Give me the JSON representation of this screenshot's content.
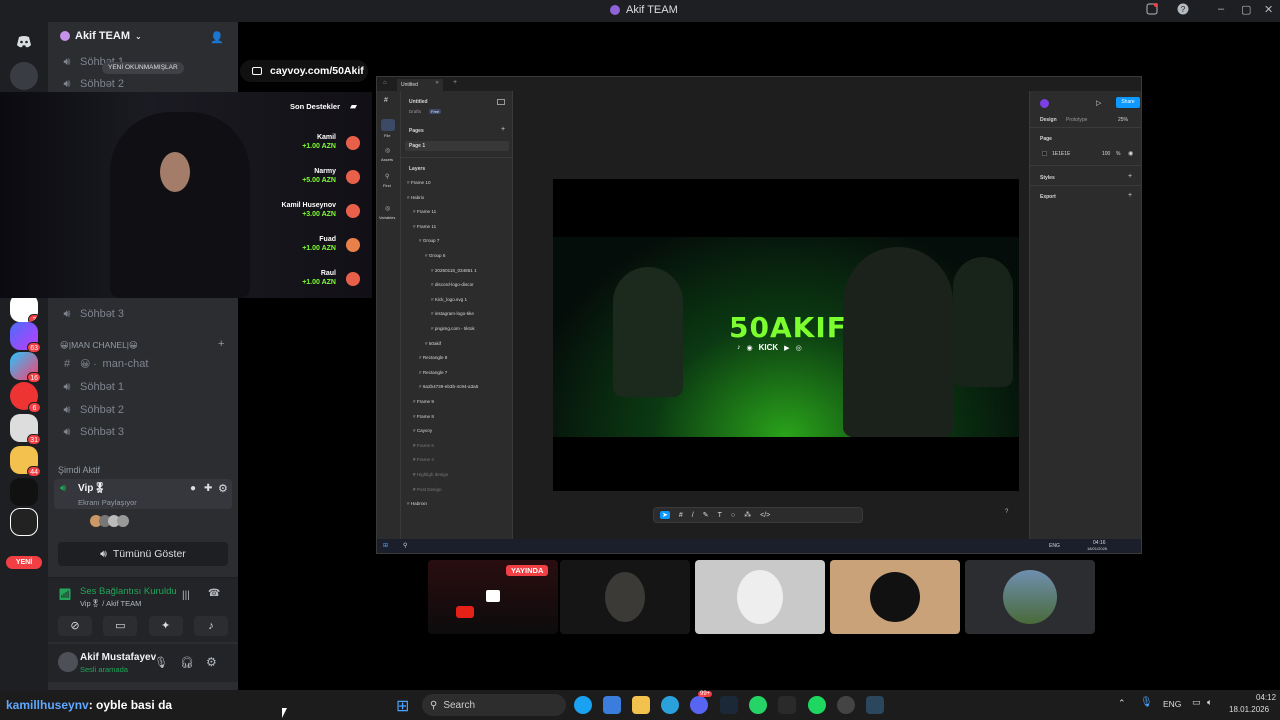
{
  "window": {
    "title": "Akif TEAM"
  },
  "server": {
    "name": "Akif TEAM",
    "unread_pill": "YENİ OKUNMAMIŞLAR",
    "new_label": "YENİ",
    "badges": [
      "3",
      "63",
      "16",
      "6",
      "31",
      "44"
    ]
  },
  "channels": {
    "top": [
      "Söhbət 1",
      "Söhbət 2"
    ],
    "more": [
      "Söhbət 3"
    ],
    "category": "😀|MAN CHANEL|😀",
    "text_channel": "man-chat",
    "list": [
      "Söhbət 1",
      "Söhbət 2",
      "Söhbət 3"
    ]
  },
  "active_now": {
    "heading": "Şimdi Aktif",
    "channel": "Vip🎖",
    "activity": "Ekranı Paylaşıyor",
    "show_all": "Tümünü Göster"
  },
  "voice_panel": {
    "status": "Ses Bağlantısı Kuruldu",
    "location": "Vip🎖 / Akif TEAM"
  },
  "user": {
    "name": "Akif Mustafayev",
    "status": "Sesli aramada"
  },
  "overlay": {
    "url": "cayvoy.com/50Akif",
    "donations_title": "Son Destekler",
    "donations": [
      {
        "name": "Kamil",
        "amount": "+1.00 AZN"
      },
      {
        "name": "Narmy",
        "amount": "+5.00 AZN"
      },
      {
        "name": "Kamil Huseynov",
        "amount": "+3.00 AZN"
      },
      {
        "name": "Fuad",
        "amount": "+1.00 AZN"
      },
      {
        "name": "Raul",
        "amount": "+1.00 AZN"
      }
    ]
  },
  "figma": {
    "tab": "Untitled",
    "file_name": "Untitled",
    "drafts": "Drafts",
    "free": "Free",
    "pages_label": "Pages",
    "page1": "Page 1",
    "layers_label": "Layers",
    "layers": [
      "Frame 10",
      "Habrix",
      "Frame 11",
      "Frame 11",
      "Group 7",
      "Group 6",
      "20260118_034851 1",
      "discord-logo-discor",
      "Kick_logo.svg 1",
      "instagram-logo-tike",
      "pngimg.com - tiktok",
      "50akif",
      "Rectangle 8",
      "Rectangle 7",
      "6a2b4739-eb3b-4c94-a3a5",
      "Frame 9",
      "Frame 8",
      "Cayvoy",
      "Frame 6",
      "Frame 4",
      "Highligh design",
      "Post Design",
      "Habrıxn"
    ],
    "rail_labels": [
      "File",
      "Assets",
      "Find",
      "Variables"
    ],
    "design_tab": "Design",
    "prototype_tab": "Prototype",
    "zoom": "25%",
    "share": "Share",
    "page_section": "Page",
    "page_color": "1E1E1E",
    "page_opacity": "100",
    "page_pct": "%",
    "styles": "Styles",
    "export": "Export",
    "banner_title": "50AKIF",
    "banner_kick": "KICK",
    "clock_time": "04:16",
    "clock_date": "18/01/2026",
    "lang": "ENG"
  },
  "stream": {
    "live_badge": "YAYINDA"
  },
  "chat": {
    "user": "kamillhuseynv",
    "message": ": oyble basi da"
  },
  "taskbar": {
    "search": "Search",
    "lang": "ENG",
    "time": "04:12",
    "date": "18.01.2026",
    "notif": "99+"
  },
  "colors": {
    "discord_bg": "#2b2d31",
    "rail_bg": "#1e1f22",
    "green": "#23a55a",
    "red": "#f23f43",
    "figma_blue": "#0d99ff",
    "banner_green": "#7cff2e"
  }
}
